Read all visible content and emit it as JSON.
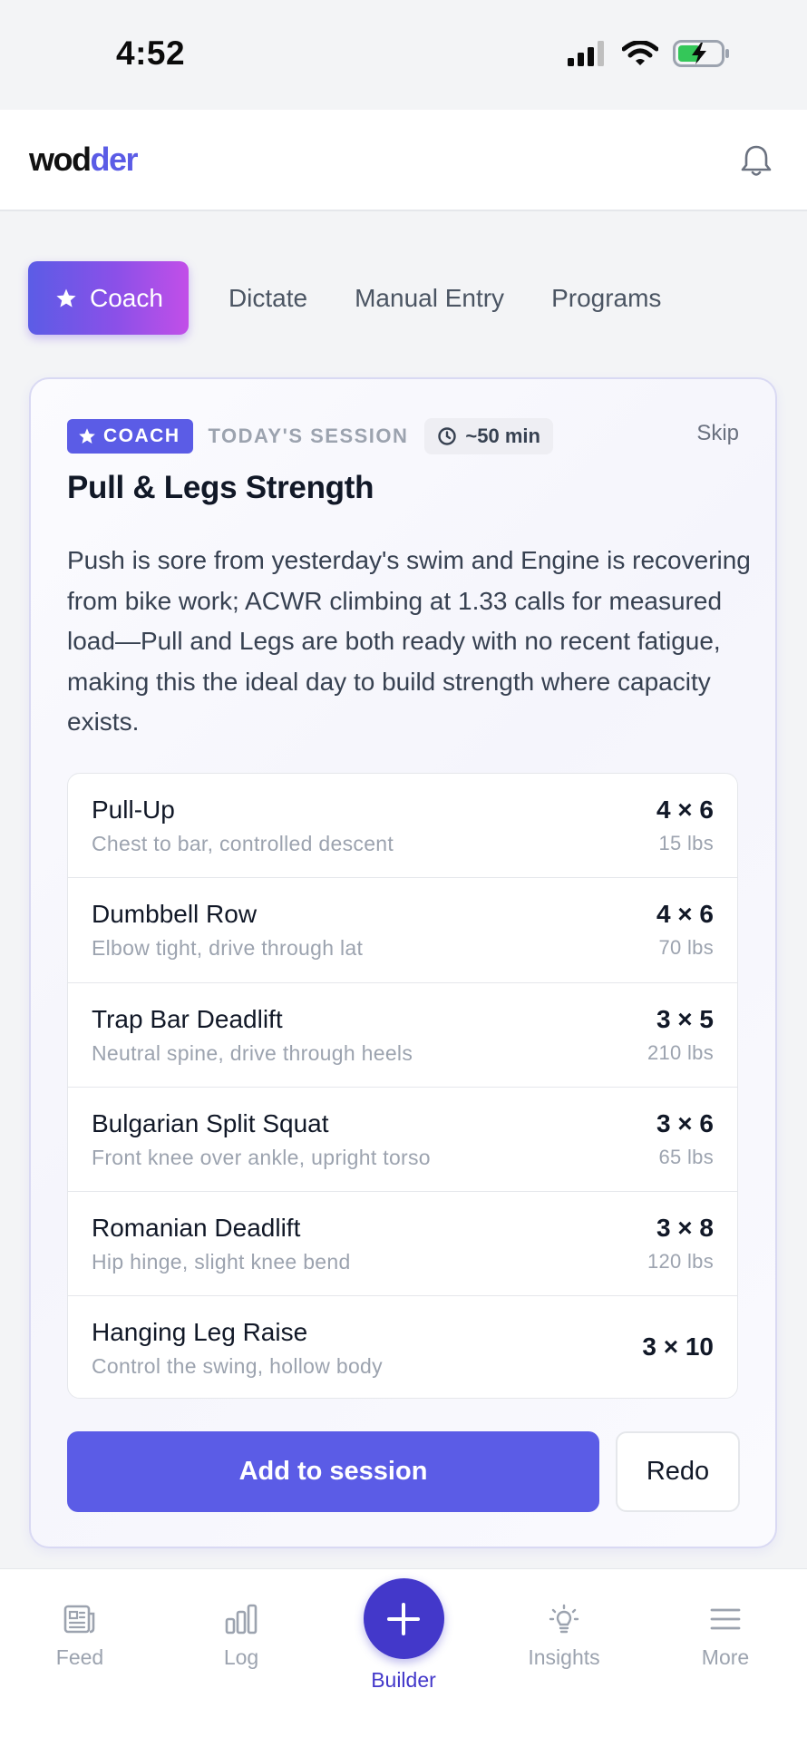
{
  "status_bar": {
    "time": "4:52"
  },
  "header": {
    "logo_part1": "wod",
    "logo_part2": "der"
  },
  "tabs": [
    {
      "label": "Coach",
      "active": true
    },
    {
      "label": "Dictate",
      "active": false
    },
    {
      "label": "Manual Entry",
      "active": false
    },
    {
      "label": "Programs",
      "active": false
    }
  ],
  "coach_card": {
    "badge": "COACH",
    "session_label": "TODAY'S SESSION",
    "duration": "~50 min",
    "skip_label": "Skip",
    "title": "Pull & Legs Strength",
    "description": "Push is sore from yesterday's swim and Engine is recovering from bike work; ACWR climbing at 1.33 calls for measured load—Pull and Legs are both ready with no recent fatigue, making this the ideal day to build strength where capacity exists.",
    "exercises": [
      {
        "name": "Pull-Up",
        "cue": "Chest to bar, controlled descent",
        "sets": "4 × 6",
        "weight": "15 lbs"
      },
      {
        "name": "Dumbbell Row",
        "cue": "Elbow tight, drive through lat",
        "sets": "4 × 6",
        "weight": "70 lbs"
      },
      {
        "name": "Trap Bar Deadlift",
        "cue": "Neutral spine, drive through heels",
        "sets": "3 × 5",
        "weight": "210 lbs"
      },
      {
        "name": "Bulgarian Split Squat",
        "cue": "Front knee over ankle, upright torso",
        "sets": "3 × 6",
        "weight": "65 lbs"
      },
      {
        "name": "Romanian Deadlift",
        "cue": "Hip hinge, slight knee bend",
        "sets": "3 × 8",
        "weight": "120 lbs"
      },
      {
        "name": "Hanging Leg Raise",
        "cue": "Control the swing, hollow body",
        "sets": "3 × 10",
        "weight": ""
      }
    ],
    "add_button": "Add to session",
    "redo_button": "Redo"
  },
  "bottom_nav": {
    "feed": "Feed",
    "log": "Log",
    "builder": "Builder",
    "insights": "Insights",
    "more": "More"
  },
  "colors": {
    "accent": "#5b5ce6",
    "builder": "#4338ca",
    "gradient_end": "#c24fe8",
    "battery_fill": "#34c759"
  },
  "icons": {
    "signal": "signal-icon",
    "wifi": "wifi-icon",
    "battery": "battery-charging-icon",
    "bell": "bell-icon",
    "star": "star-icon",
    "clock": "clock-icon",
    "feed": "newspaper-icon",
    "log": "bar-chart-icon",
    "builder": "plus-icon",
    "insights": "lightbulb-icon",
    "more": "hamburger-menu-icon"
  }
}
